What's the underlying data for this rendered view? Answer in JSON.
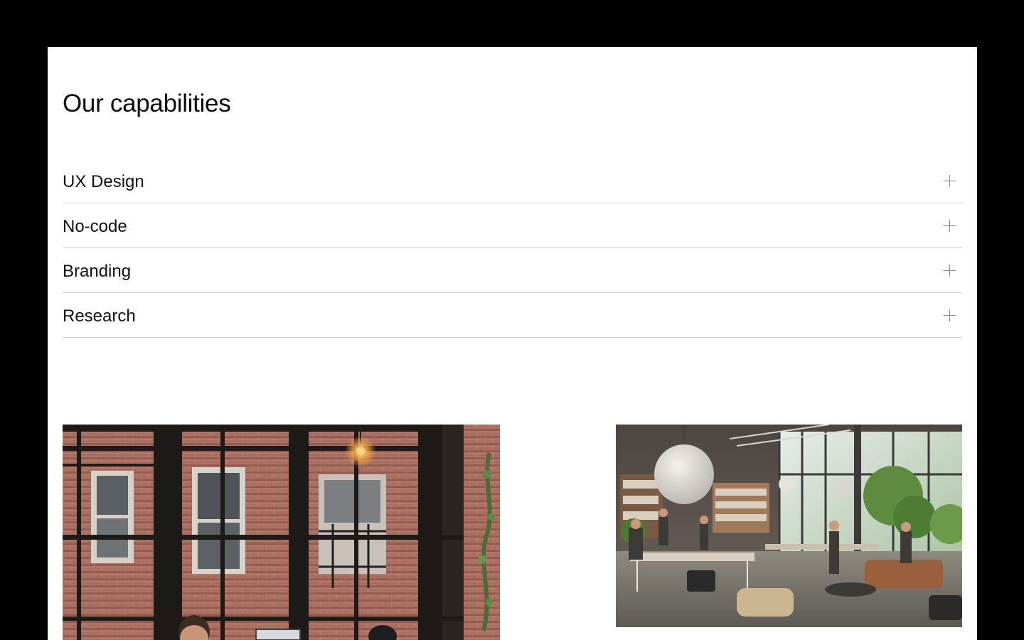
{
  "section": {
    "title": "Our capabilities"
  },
  "capabilities": [
    {
      "label": "UX Design",
      "icon": "plus-icon"
    },
    {
      "label": "No-code",
      "icon": "plus-icon"
    },
    {
      "label": "Branding",
      "icon": "plus-icon"
    },
    {
      "label": "Research",
      "icon": "plus-icon"
    }
  ],
  "images": [
    {
      "name": "loft-office-windows-photo"
    },
    {
      "name": "open-plan-office-photo"
    }
  ],
  "colors": {
    "background": "#000000",
    "surface": "#ffffff",
    "text": "#111111",
    "divider": "#cfcfcf",
    "icon": "#8a8a8a"
  }
}
